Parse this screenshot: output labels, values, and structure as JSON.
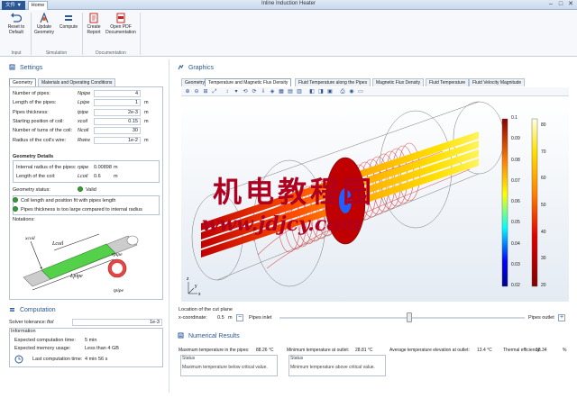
{
  "window": {
    "title": "Inline Induction Heater",
    "file_label": "文件 ▼",
    "home_tab": "Home",
    "min": "–",
    "max": "□",
    "close": "✕"
  },
  "ribbon": {
    "buttons": [
      {
        "label": "Reset to\nDefault",
        "icon": "reset-icon"
      },
      {
        "label": "Update\nGeometry",
        "icon": "geometry-icon"
      },
      {
        "label": "Compute",
        "icon": "compute-icon"
      },
      {
        "label": "Create\nReport",
        "icon": "report-icon"
      },
      {
        "label": "Open PDF\nDocumentation",
        "icon": "pdf-icon"
      }
    ],
    "groups": [
      "Input",
      "Simulation",
      "Documentation"
    ]
  },
  "settings": {
    "title": "Settings",
    "tabs": [
      "Geometry",
      "Materials and Operating Conditions"
    ],
    "params": [
      {
        "label": "Number of pipes:",
        "sym": "Npipe",
        "value": "4",
        "unit": ""
      },
      {
        "label": "Length of the pipes:",
        "sym": "Lpipe",
        "value": "1",
        "unit": "m"
      },
      {
        "label": "Pipes thickness:",
        "sym": "tpipe",
        "value": "2e-3",
        "unit": "m"
      },
      {
        "label": "Starting position of coil:",
        "sym": "xcoil",
        "value": "0.15",
        "unit": "m"
      },
      {
        "label": "Number of turns of the coil:",
        "sym": "Ncoil",
        "value": "30",
        "unit": ""
      },
      {
        "label": "Radius of the coil's wire:",
        "sym": "Rwire",
        "value": "1e-2",
        "unit": "m"
      }
    ],
    "details_title": "Geometry Details",
    "details": [
      {
        "label": "Internal radius of the pipes:",
        "sym": "rpipe",
        "value": "0.00898",
        "unit": "m"
      },
      {
        "label": "Length of the coil:",
        "sym": "Lcoil",
        "value": "0.6",
        "unit": "m"
      }
    ],
    "status_label": "Geometry status:",
    "status_value": "Valid",
    "checks": [
      "Coil length and position fit with pipes length",
      "Pipes thickness is too large compared to internal radius"
    ],
    "notations": "Notations:",
    "diagram_labels": {
      "xcoil": "xcoil",
      "lcoil": "Lcoil",
      "lpipe": "Lpipe",
      "rpipe": "rpipe",
      "tpipe": "tpipe"
    }
  },
  "computation": {
    "title": "Computation",
    "solver_label": "Solver tolerance:",
    "solver_sym": "ftol",
    "solver_value": "1e-3",
    "info_title": "Information",
    "rows": [
      {
        "label": "Expected computation time:",
        "value": "5 min"
      },
      {
        "label": "Expected memory usage:",
        "value": "Less than 4 GB"
      },
      {
        "label": "Last computation time:",
        "value": "4 min 56 s"
      }
    ]
  },
  "graphics": {
    "title": "Graphics",
    "tabs": [
      "Geometry",
      "Temperature and Magnetic Flux Density",
      "Fluid Temperature along the Pipes",
      "Magnetic Flux Density",
      "Fluid Temperature",
      "Fluid Velocity Magnitude"
    ],
    "active_tab": 1,
    "legend_left": [
      "0.1",
      "0.09",
      "0.08",
      "0.07",
      "0.06",
      "0.05",
      "0.04",
      "0.03",
      "0.02"
    ],
    "legend_right": [
      "80",
      "70",
      "60",
      "50",
      "40",
      "30",
      "20"
    ],
    "colors": {
      "accent": "#2b5797"
    }
  },
  "cutplane": {
    "title": "Location of the cut plane",
    "label": "x-coordinate:",
    "value": "0.5",
    "unit": "m",
    "left": "Pipes inlet",
    "right": "Pipes outlet",
    "position": 0.53
  },
  "results": {
    "title": "Numerical Results",
    "items": [
      {
        "label": "Maximum temperature in the pipes:",
        "value": "88.26 °C",
        "status": "Maximum temperature below critical value."
      },
      {
        "label": "Minimum temperature at outlet:",
        "value": "28.81 °C",
        "status": "Minimum temperature above critical value."
      },
      {
        "label": "Average temperature elevation at outlet:",
        "value": "13.4 °C",
        "status": ""
      },
      {
        "label": "Thermal efficiency:",
        "value": "18.34",
        "unit": "%",
        "status": ""
      }
    ],
    "status_label": "Status"
  },
  "watermark": {
    "cn": "机电教程园",
    "url": "www.jdjcy.com"
  }
}
